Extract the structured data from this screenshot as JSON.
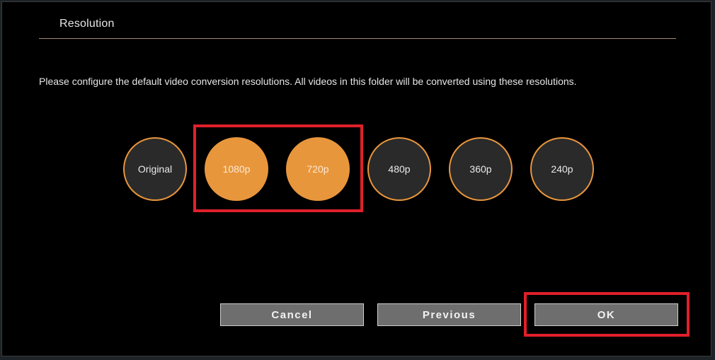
{
  "dialog": {
    "title": "Resolution",
    "description": "Please configure the default video conversion resolutions. All videos in this folder will be converted using these resolutions."
  },
  "resolutions": [
    {
      "label": "Original",
      "selected": false
    },
    {
      "label": "1080p",
      "selected": true
    },
    {
      "label": "720p",
      "selected": true
    },
    {
      "label": "480p",
      "selected": false
    },
    {
      "label": "360p",
      "selected": false
    },
    {
      "label": "240p",
      "selected": false
    }
  ],
  "buttons": {
    "cancel": "Cancel",
    "previous": "Previous",
    "ok": "OK"
  },
  "colors": {
    "accent": "#e8963c",
    "unselected_fill": "#2a2a2a",
    "highlight": "#e0202a",
    "button_fill": "#6e6e6e"
  }
}
